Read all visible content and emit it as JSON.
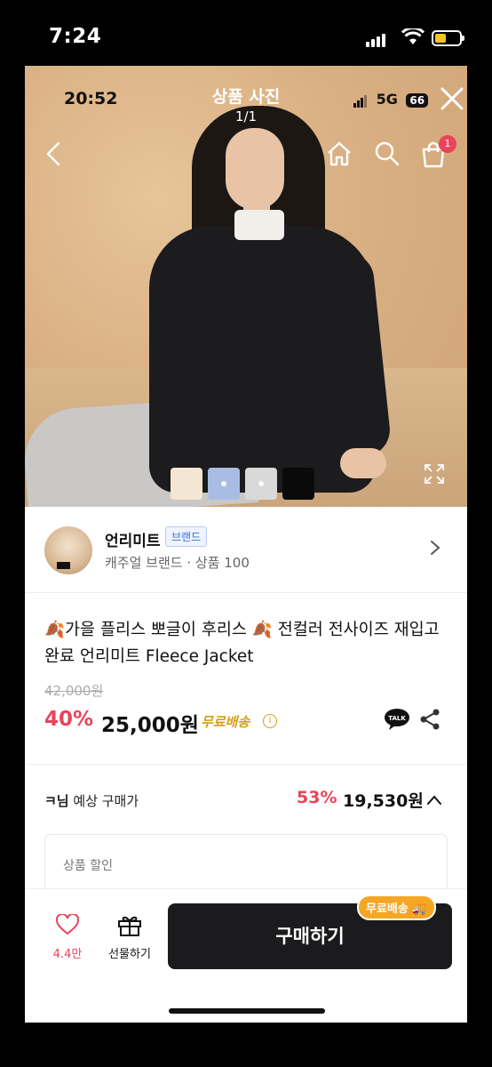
{
  "outer_status": {
    "time": "7:24"
  },
  "inner_status": {
    "time": "20:52",
    "network": "5G",
    "battery": "66"
  },
  "viewer": {
    "title": "상품 사진",
    "counter": "1/1"
  },
  "nav": {
    "cart_count": "1"
  },
  "swatches": [
    {
      "color": "#f3e6d2"
    },
    {
      "color": "#a9bde3"
    },
    {
      "color": "#d9d9d9"
    },
    {
      "color": "#0a0a0a"
    }
  ],
  "brand": {
    "name": "언리미트",
    "badge": "브랜드",
    "subtitle": "캐주얼 브랜드 · 상품 100"
  },
  "product": {
    "title": "🍂가을 플리스 뽀글이 후리스 🍂 전컬러 전사이즈 재입고 완료 언리미트 Fleece Jacket",
    "original_price": "42,000원",
    "discount_rate": "40%",
    "sale_price": "25,000원",
    "shipping": "무료배송"
  },
  "expected": {
    "user": "ㅋ님",
    "label": "예상 구매가",
    "rate": "53%",
    "price": "19,530원"
  },
  "discount_box": {
    "label": "상품 할인"
  },
  "bottom": {
    "like_count": "4.4만",
    "gift_label": "선물하기",
    "buy_label": "구매하기",
    "ship_pill": "무료배송 🚚"
  },
  "colors": {
    "accent": "#e8445a",
    "gold": "#d4a017",
    "dark": "#1b1b1d"
  }
}
